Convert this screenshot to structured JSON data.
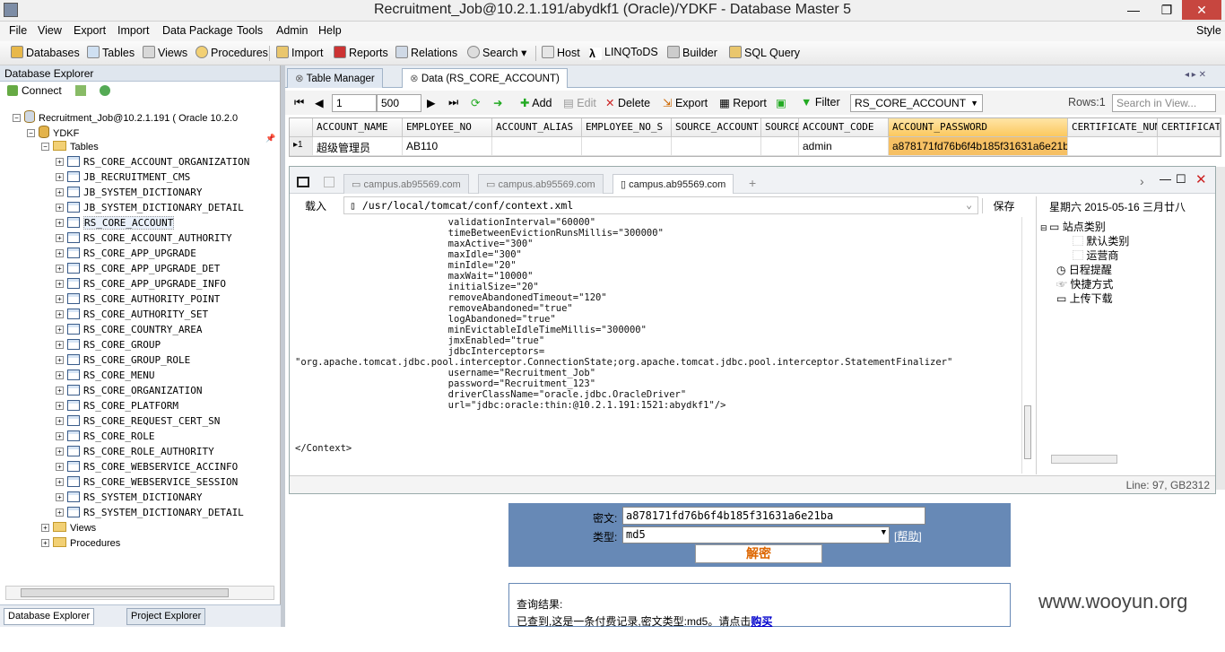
{
  "window": {
    "title": "Recruitment_Job@10.2.1.191/abydkf1 (Oracle)/YDKF - Database Master 5",
    "minimize": "—",
    "restore": "❐",
    "close": "✕"
  },
  "menu": {
    "items": [
      "File",
      "View",
      "Export",
      "Import",
      "Data Package",
      "Tools",
      "Admin",
      "Help"
    ],
    "style": "Style"
  },
  "toolbar": {
    "items": [
      "Databases",
      "Tables",
      "Views",
      "Procedures",
      "Import",
      "Reports",
      "Relations",
      "Search",
      "Host",
      "LINQToDS",
      "Builder",
      "SQL Query"
    ]
  },
  "explorer": {
    "header": "Database Explorer",
    "pin": "📌",
    "connect": "Connect",
    "root": "Recruitment_Job@10.2.1.191 ( Oracle  10.2.0",
    "schema": "YDKF",
    "tables_folder": "Tables",
    "views_folder": "Views",
    "procedures_folder": "Procedures",
    "tables": [
      "RS_CORE_ACCOUNT_ORGANIZATION",
      "JB_RECRUITMENT_CMS",
      "JB_SYSTEM_DICTIONARY",
      "JB_SYSTEM_DICTIONARY_DETAIL",
      "RS_CORE_ACCOUNT",
      "RS_CORE_ACCOUNT_AUTHORITY",
      "RS_CORE_APP_UPGRADE",
      "RS_CORE_APP_UPGRADE_DET",
      "RS_CORE_APP_UPGRADE_INFO",
      "RS_CORE_AUTHORITY_POINT",
      "RS_CORE_AUTHORITY_SET",
      "RS_CORE_COUNTRY_AREA",
      "RS_CORE_GROUP",
      "RS_CORE_GROUP_ROLE",
      "RS_CORE_MENU",
      "RS_CORE_ORGANIZATION",
      "RS_CORE_PLATFORM",
      "RS_CORE_REQUEST_CERT_SN",
      "RS_CORE_ROLE",
      "RS_CORE_ROLE_AUTHORITY",
      "RS_CORE_WEBSERVICE_ACCINFO",
      "RS_CORE_WEBSERVICE_SESSION",
      "RS_SYSTEM_DICTIONARY",
      "RS_SYSTEM_DICTIONARY_DETAIL"
    ],
    "bottom_tabs": [
      "Database Explorer",
      "Project Explorer"
    ]
  },
  "doc_tabs": [
    "Table Manager",
    "Data (RS_CORE_ACCOUNT)"
  ],
  "grid_toolbar": {
    "row_from": "1",
    "row_count": "500",
    "add": "Add",
    "edit": "Edit",
    "delete": "Delete",
    "export": "Export",
    "report": "Report",
    "filter": "Filter",
    "table_select": "RS_CORE_ACCOUNT",
    "rows": "Rows:1",
    "search_placeholder": "Search in View..."
  },
  "grid": {
    "columns": [
      "ACCOUNT_NAME",
      "EMPLOYEE_NO",
      "ACCOUNT_ALIAS",
      "EMPLOYEE_NO_S",
      "SOURCE_ACCOUNT",
      "SOURCE",
      "ACCOUNT_CODE",
      "ACCOUNT_PASSWORD",
      "CERTIFICATE_NUM",
      "CERTIFICATE"
    ],
    "row_indicator": "▸1",
    "row": [
      "超级管理员",
      "AB110",
      "",
      "",
      "",
      "",
      "admin",
      "a878171fd76b6f4b185f31631a6e21ba",
      "",
      ""
    ]
  },
  "browser": {
    "tabs": [
      "campus.ab95569.com",
      "campus.ab95569.com",
      "campus.ab95569.com"
    ],
    "load": "载入",
    "path": "/usr/local/tomcat/conf/context.xml",
    "save": "保存",
    "date": "星期六 2015-05-16 三月廿八",
    "code_lines": [
      "                           validationInterval=\"60000\"",
      "                           timeBetweenEvictionRunsMillis=\"300000\"",
      "                           maxActive=\"300\"",
      "                           maxIdle=\"300\"",
      "                           minIdle=\"20\"",
      "                           maxWait=\"10000\"",
      "                           initialSize=\"20\"",
      "                           removeAbandonedTimeout=\"120\"",
      "                           removeAbandoned=\"true\"",
      "                           logAbandoned=\"true\"",
      "                           minEvictableIdleTimeMillis=\"300000\"",
      "                           jmxEnabled=\"true\"",
      "                           jdbcInterceptors=",
      "\"org.apache.tomcat.jdbc.pool.interceptor.ConnectionState;org.apache.tomcat.jdbc.pool.interceptor.StatementFinalizer\"",
      "                           username=\"Recruitment_Job\"",
      "                           password=\"Recruitment_123\"",
      "                           driverClassName=\"oracle.jdbc.OracleDriver\"",
      "                           url=\"jdbc:oracle:thin:@10.2.1.191:1521:abydkf1\"/>",
      "",
      "",
      "",
      "</Context>"
    ],
    "side": {
      "site_cat": "站点类别",
      "default_cat": "默认类别",
      "operator": "运营商",
      "schedule": "日程提醒",
      "shortcut": "快捷方式",
      "upload": "上传下载"
    },
    "status": "Line: 97, GB2312"
  },
  "decrypt": {
    "cipher_label": "密文:",
    "cipher_value": "a878171fd76b6f4b185f31631a6e21ba",
    "type_label": "类型:",
    "type_value": "md5",
    "help": "[帮助]",
    "button": "解密"
  },
  "result": {
    "label": "查询结果:",
    "text": "已查到,这是一条付费记录,密文类型:md5。请点击",
    "buy": "购买"
  },
  "watermark": "www.wooyun.org"
}
